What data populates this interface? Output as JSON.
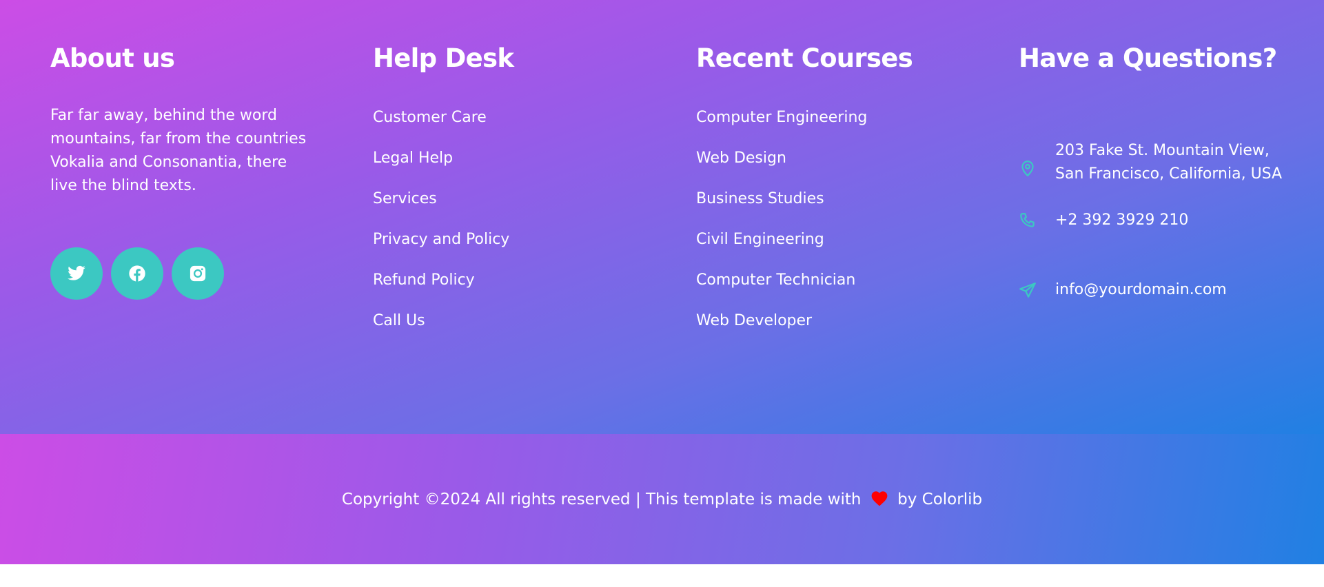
{
  "about": {
    "title": "About us",
    "text": "Far far away, behind the word mountains, far from the countries Vokalia and Consonantia, there live the blind texts.",
    "socials": [
      "twitter-icon",
      "facebook-icon",
      "instagram-icon"
    ]
  },
  "help": {
    "title": "Help Desk",
    "items": [
      "Customer Care",
      "Legal Help",
      "Services",
      "Privacy and Policy",
      "Refund Policy",
      "Call Us"
    ]
  },
  "courses": {
    "title": "Recent Courses",
    "items": [
      "Computer Engineering",
      "Web Design",
      "Business Studies",
      "Civil Engineering",
      "Computer Technician",
      "Web Developer"
    ]
  },
  "contact": {
    "title": "Have a Questions?",
    "address": "203 Fake St. Mountain View, San Francisco, California, USA",
    "phone": "+2 392 3929 210",
    "email": "info@yourdomain.com"
  },
  "footer": {
    "copyright_prefix": "Copyright ©2024 All rights reserved | This template is made with",
    "copyright_by": "by",
    "author": "Colorlib"
  },
  "colors": {
    "accent": "#3cc8c2",
    "heart": "#ff0000",
    "gradient_start": "#cc4de6",
    "gradient_end": "#2080e3"
  }
}
